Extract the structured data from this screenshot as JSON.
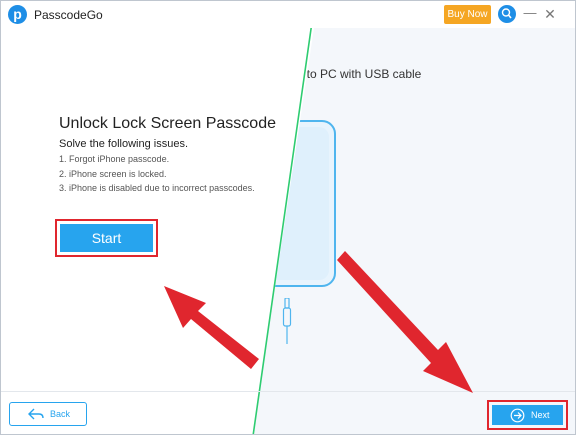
{
  "app": {
    "title": "PasscodeGo",
    "logo_letter": "p"
  },
  "titlebar": {
    "buy_now": "Buy Now",
    "search_icon": "search-icon",
    "minimize_icon": "minimize-icon",
    "close_icon": "close-icon"
  },
  "connect_panel": {
    "text": "cted to PC with USB cable"
  },
  "main": {
    "heading": "Unlock Lock Screen Passcode",
    "subheading": "Solve the following issues.",
    "issues": [
      "1. Forgot iPhone passcode.",
      "2. iPhone screen is locked.",
      "3. iPhone is disabled due to incorrect passcodes."
    ],
    "start_label": "Start"
  },
  "footer": {
    "back_label": "Back",
    "next_label": "Next"
  },
  "colors": {
    "accent": "#27a4ee",
    "highlight": "#e0262e",
    "buy_now": "#f5a623",
    "page_edge": "#2ecc71"
  }
}
